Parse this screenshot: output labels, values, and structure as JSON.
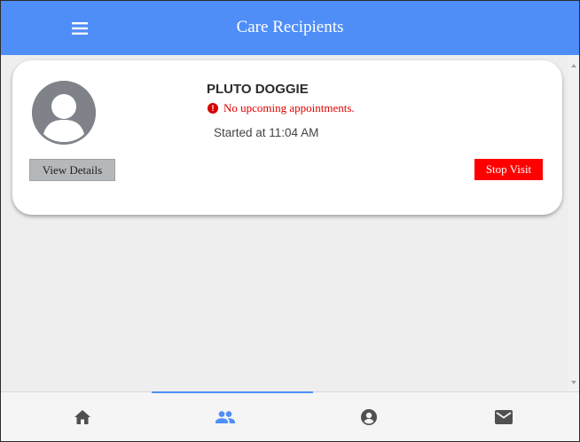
{
  "header": {
    "title": "Care Recipients",
    "menu_icon": "hamburger-menu-icon",
    "color": "#4f8ef7"
  },
  "recipient": {
    "name": "PLUTO DOGGIE",
    "appointment_status": "No upcoming appointments.",
    "started": "Started at 11:04 AM",
    "view_details_label": "View Details",
    "stop_visit_label": "Stop Visit",
    "avatar_icon": "person-avatar-icon",
    "alert_icon": "exclamation-circle-icon",
    "alert_color": "#e00000",
    "stop_color": "#ff0000"
  },
  "bottom_nav": {
    "active_tab": "care-recipients",
    "tabs": [
      {
        "id": "home",
        "icon": "home-icon"
      },
      {
        "id": "care-recipients",
        "icon": "people-icon"
      },
      {
        "id": "profile",
        "icon": "account-circle-icon"
      },
      {
        "id": "messages",
        "icon": "mail-icon"
      }
    ]
  }
}
